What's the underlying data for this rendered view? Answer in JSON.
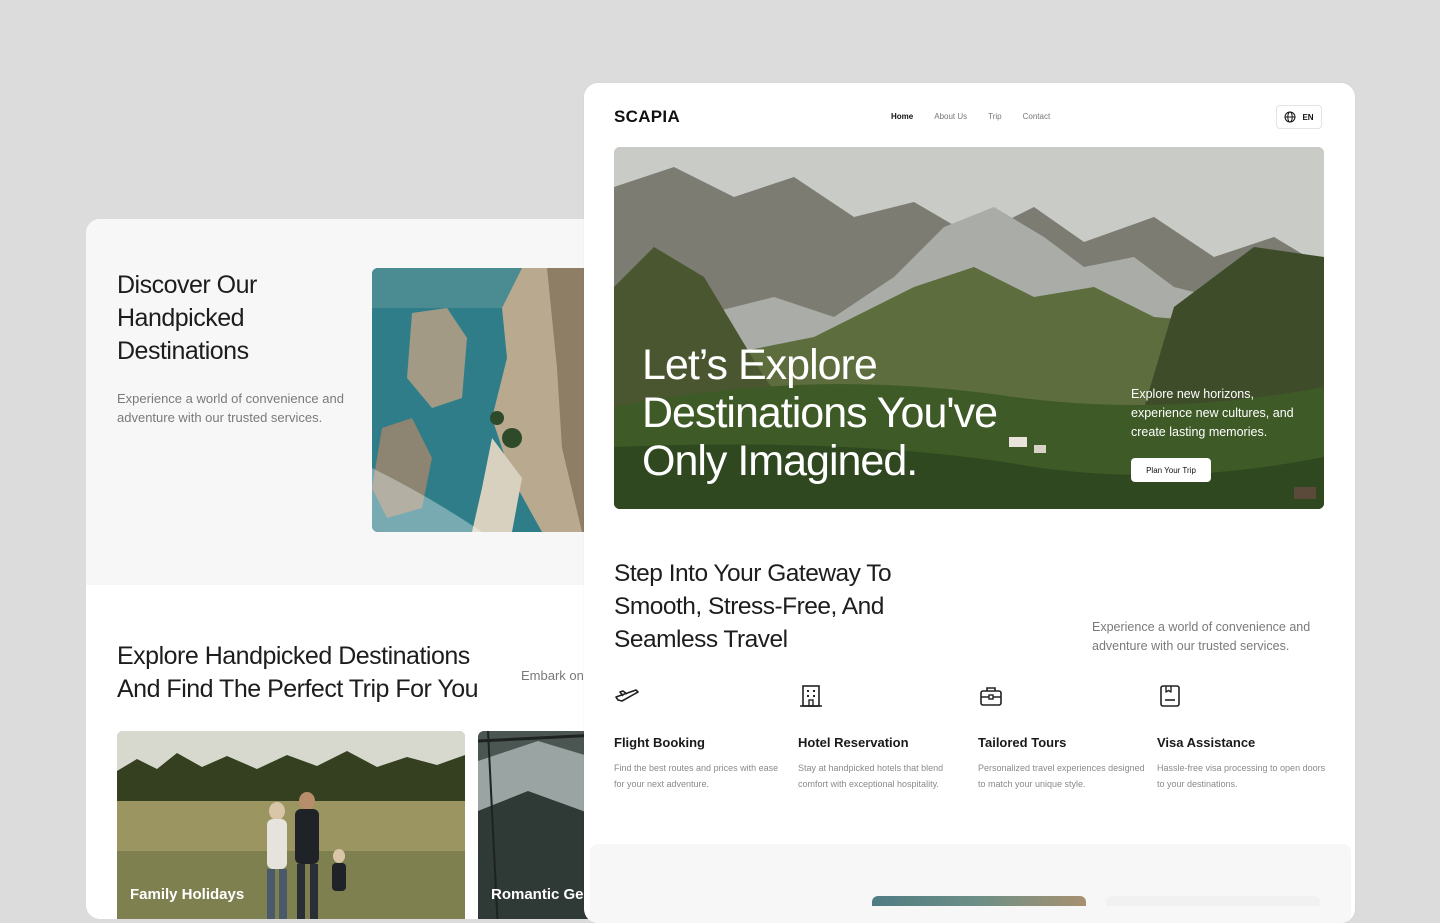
{
  "back_card": {
    "title": "Discover Our Handpicked Destinations",
    "subtitle": "Experience a world of convenience and adventure with our trusted services.",
    "explore_title": "Explore Handpicked Destinations And Find The Perfect Trip For You",
    "embark_text": "Embark on your guide.",
    "cards": [
      {
        "label": "Family Holidays"
      },
      {
        "label": "Romantic Ge"
      }
    ]
  },
  "front_card": {
    "logo": "SCAPIA",
    "nav": [
      "Home",
      "About Us",
      "Trip",
      "Contact"
    ],
    "nav_active": "Home",
    "lang": "EN",
    "hero": {
      "title": "Let’s Explore Destinations You've Only Imagined.",
      "side_text": "Explore new horizons, experience new cultures, and create lasting memories.",
      "cta": "Plan Your Trip"
    },
    "section_title": "Step Into Your Gateway To Smooth, Stress-Free, And Seamless Travel",
    "section_sub": "Experience a world of convenience and adventure with our trusted services.",
    "services": [
      {
        "icon": "plane-icon",
        "title": "Flight Booking",
        "desc": "Find the best routes and prices with ease for your next adventure."
      },
      {
        "icon": "building-icon",
        "title": "Hotel Reservation",
        "desc": "Stay at handpicked hotels that blend comfort with exceptional hospitality."
      },
      {
        "icon": "briefcase-icon",
        "title": "Tailored Tours",
        "desc": "Personalized travel experiences designed to match your unique style."
      },
      {
        "icon": "passport-icon",
        "title": "Visa Assistance",
        "desc": "Hassle-free visa processing to open doors to your destinations."
      }
    ]
  },
  "colors": {
    "background": "#dcdcdc",
    "card": "#ffffff",
    "text_dark": "#1d1d1d",
    "text_muted": "#7a7a7a"
  }
}
